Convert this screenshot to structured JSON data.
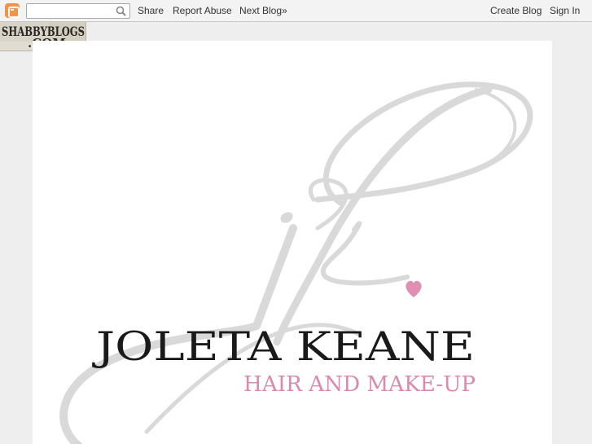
{
  "navbar": {
    "search_placeholder": "",
    "share_label": "Share",
    "report_abuse_label": "Report Abuse",
    "next_blog_label": "Next Blog»",
    "create_blog_label": "Create Blog",
    "sign_in_label": "Sign In"
  },
  "badge": {
    "line1": "SHABBYBLOGS",
    "line2": ".COM"
  },
  "header": {
    "name": "JOLETA KEANE",
    "tagline": "HAIR AND MAKE-UP",
    "monogram": "jk"
  },
  "colors": {
    "accent_pink": "#e08fb3",
    "tagline_pink": "#d98aae",
    "monogram_gray": "#d8d8d8",
    "name_black": "#1a1a1a",
    "blogger_orange": "#f4914b"
  },
  "icons": [
    "blogger-logo-icon",
    "search-icon",
    "heart-icon"
  ]
}
